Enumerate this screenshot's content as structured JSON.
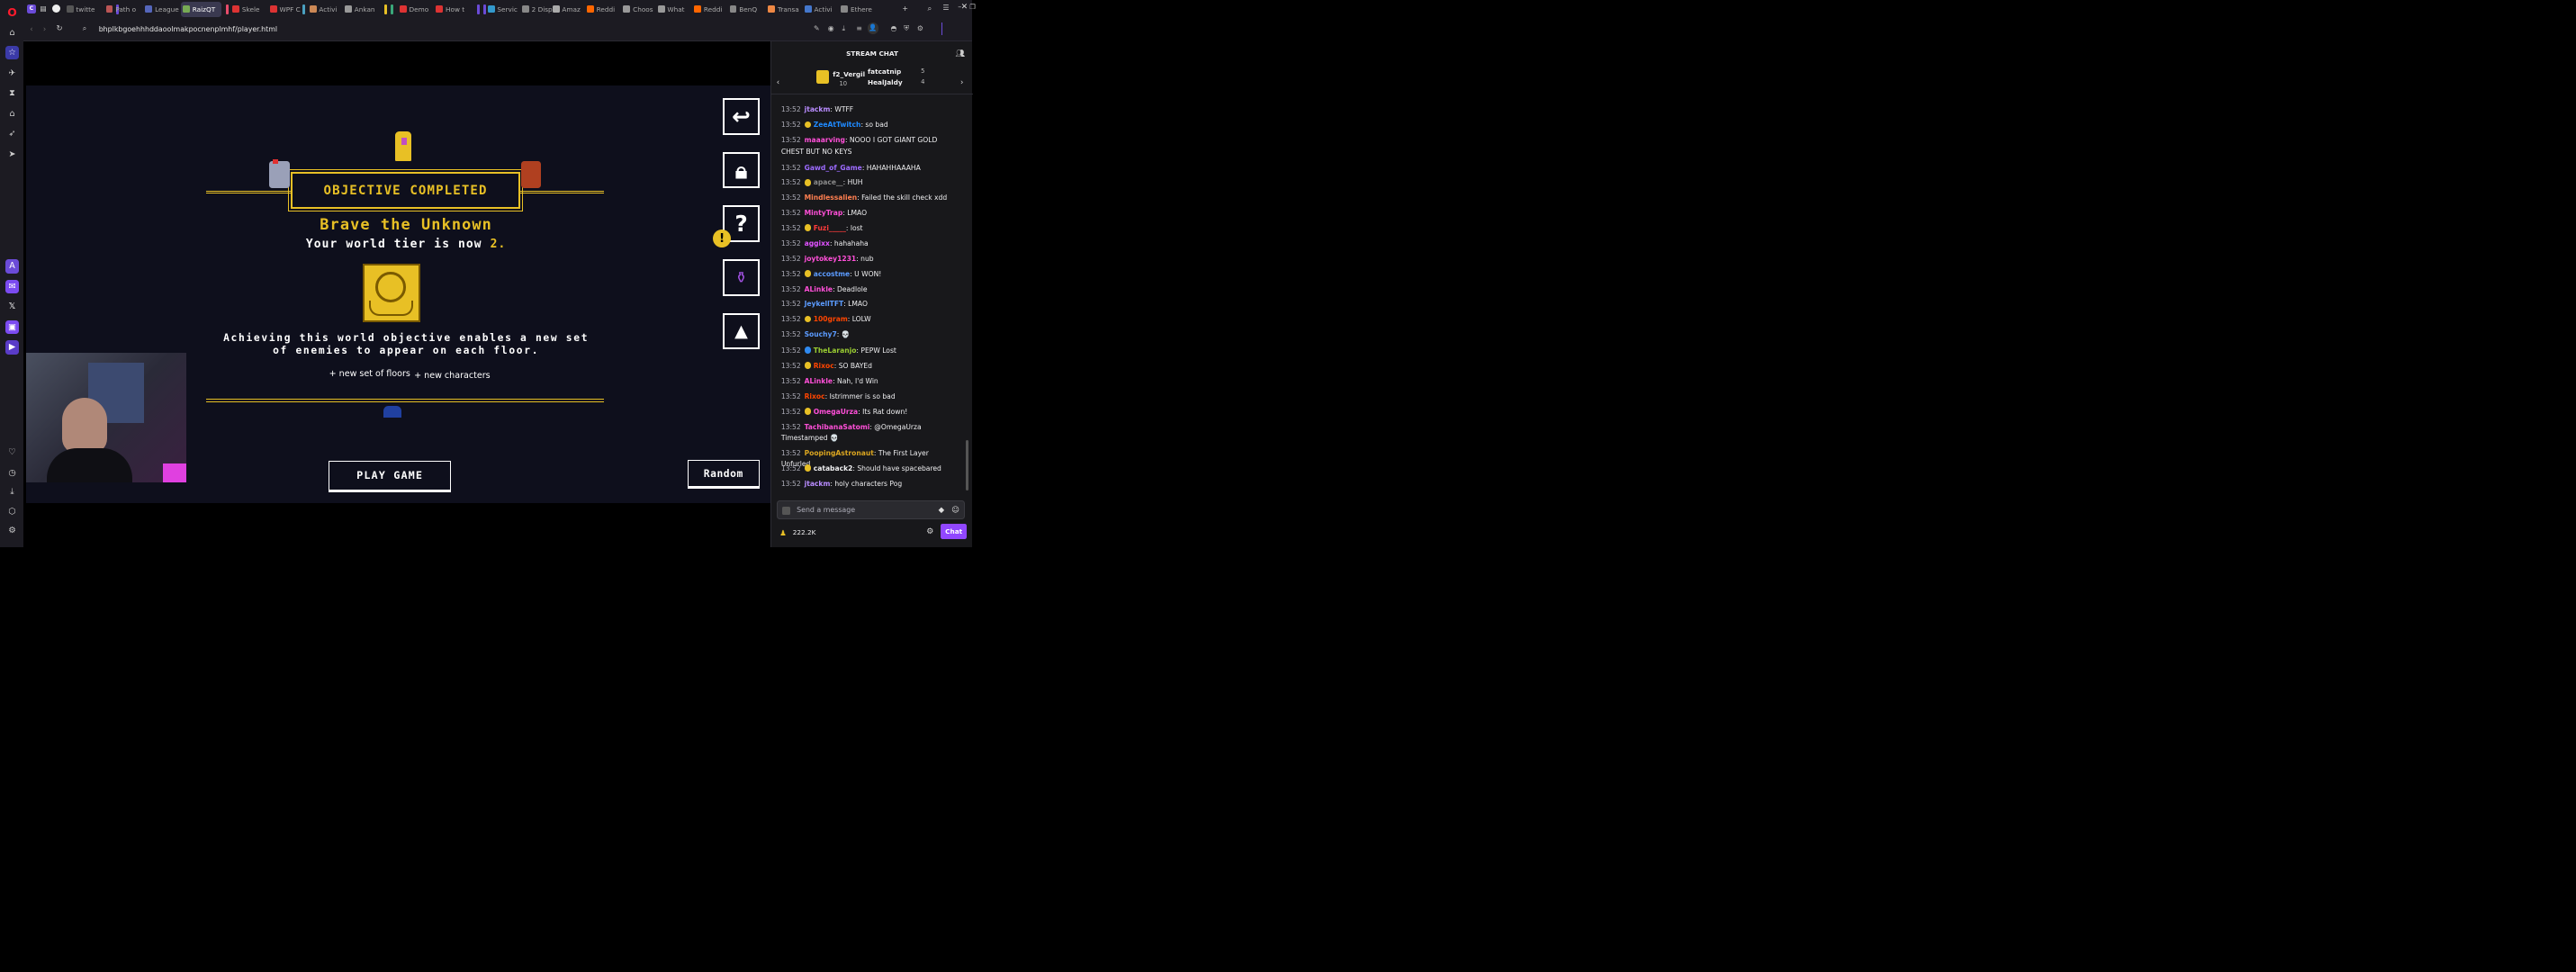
{
  "browser": {
    "tabs": [
      {
        "label": "twitte",
        "color": "#555"
      },
      {
        "label": "Path o",
        "color": "#b55"
      },
      {
        "label": "League",
        "color": "#56b"
      },
      {
        "label": "RaizQT",
        "color": "#7a5"
      },
      {
        "label": "Skele",
        "color": "#d33"
      },
      {
        "label": "WPF C",
        "color": "#d33"
      },
      {
        "label": "Activi",
        "color": "#c85"
      },
      {
        "label": "Ankan",
        "color": "#999"
      },
      {
        "label": "Demo",
        "color": "#d33"
      },
      {
        "label": "How t",
        "color": "#d33"
      },
      {
        "label": "Servic",
        "color": "#39c"
      },
      {
        "label": "2 Disp",
        "color": "#888"
      },
      {
        "label": "Amaz",
        "color": "#aaa"
      },
      {
        "label": "Reddi",
        "color": "#f60"
      },
      {
        "label": "Choos",
        "color": "#999"
      },
      {
        "label": "What",
        "color": "#999"
      },
      {
        "label": "Reddi",
        "color": "#f60"
      },
      {
        "label": "BenQ",
        "color": "#888"
      },
      {
        "label": "Transa",
        "color": "#e84"
      },
      {
        "label": "Activi",
        "color": "#47c"
      },
      {
        "label": "Ethere",
        "color": "#888"
      }
    ],
    "url": "bhplkbgoehhhddaoolmakpocnenplmhf/player.html"
  },
  "game": {
    "banner": "OBJECTIVE COMPLETED",
    "title": "Brave the Unknown",
    "tier_text": "Your world tier is now",
    "tier_value": "2.",
    "desc_line1": "Achieving this world objective enables a new set",
    "desc_line2": "of enemies to appear on each floor.",
    "bullet1": "+ new set of floors",
    "bullet2": "+ new characters",
    "play_button": "PLAY GAME",
    "random_button": "Random"
  },
  "chat": {
    "header": "STREAM CHAT",
    "gifters": [
      {
        "name": "f2_Vergil",
        "count": "10"
      },
      {
        "name": "fatcatnip",
        "count": "5"
      },
      {
        "name": "HealJaldy",
        "count": "4"
      }
    ],
    "messages": [
      {
        "time": "13:52",
        "user": "jtackm",
        "color": "#b98cff",
        "text": "WTFF"
      },
      {
        "time": "13:52",
        "user": "ZeeAtTwitch",
        "color": "#1f8aff",
        "text": "so bad"
      },
      {
        "time": "13:52",
        "user": "maaarving",
        "color": "#ff4fd8",
        "text": "NOOO I GOT GIANT GOLD CHEST BUT NO KEYS"
      },
      {
        "time": "13:52",
        "user": "Gawd_of_Game",
        "color": "#9d6bff",
        "text": "HAHAHHAAAHA"
      },
      {
        "time": "13:52",
        "user": "apace__",
        "color": "#8a8a8a",
        "text": "HUH"
      },
      {
        "time": "13:52",
        "user": "Mindlessalien",
        "color": "#ff7f50",
        "text": "Failed the skill check xdd"
      },
      {
        "time": "13:52",
        "user": "MintyTrap",
        "color": "#ff4fd8",
        "text": "LMAO"
      },
      {
        "time": "13:52",
        "user": "Fuzi_____",
        "color": "#ff3b3b",
        "text": "lost"
      },
      {
        "time": "13:52",
        "user": "aggixx",
        "color": "#e052ff",
        "text": "hahahaha"
      },
      {
        "time": "13:52",
        "user": "joytokey1231",
        "color": "#ff4fd8",
        "text": "nub"
      },
      {
        "time": "13:52",
        "user": "accostme",
        "color": "#5b9bff",
        "text": "U WON!"
      },
      {
        "time": "13:52",
        "user": "ALinkle",
        "color": "#ff4fd8",
        "text": "Deadlole"
      },
      {
        "time": "13:52",
        "user": "JeykellTFT",
        "color": "#5b9bff",
        "text": "LMAO"
      },
      {
        "time": "13:52",
        "user": "100gram",
        "color": "#ff4500",
        "text": "LOLW"
      },
      {
        "time": "13:52",
        "user": "Souchy7",
        "color": "#5b9bff",
        "text": "💀"
      },
      {
        "time": "13:52",
        "user": "TheLaranjo",
        "color": "#9acd32",
        "text": "PEPW Lost"
      },
      {
        "time": "13:52",
        "user": "Rixoc",
        "color": "#ff4500",
        "text": "SO BAYEd"
      },
      {
        "time": "13:52",
        "user": "ALinkle",
        "color": "#ff4fd8",
        "text": "Nah, I'd Win"
      },
      {
        "time": "13:52",
        "user": "Rixoc",
        "color": "#ff4500",
        "text": "Istrimmer is so bad"
      },
      {
        "time": "13:52",
        "user": "OmegaUrza",
        "color": "#ff4fd8",
        "text": "Its Rat down!"
      },
      {
        "time": "13:52",
        "user": "TachibanaSatomi",
        "color": "#ff4fd8",
        "text": "@OmegaUrza Timestamped 💀"
      },
      {
        "time": "13:52",
        "user": "PoopingAstronaut",
        "color": "#daa520",
        "text": "The First Layer Unfurled"
      },
      {
        "time": "13:52",
        "user": "catаback2",
        "color": "#efeff1",
        "text": "Should have spacebared"
      },
      {
        "time": "13:52",
        "user": "jtackm",
        "color": "#b98cff",
        "text": "holy characters Pog"
      }
    ],
    "input_placeholder": "Send a message",
    "points": "222.2K",
    "chat_button": "Chat"
  }
}
